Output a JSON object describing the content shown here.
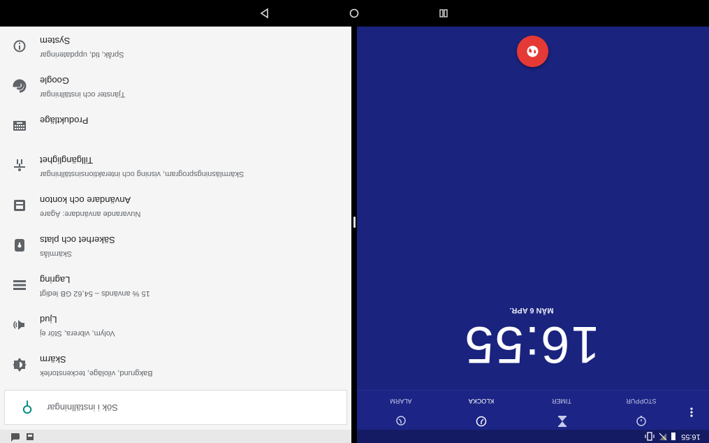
{
  "settings": {
    "search_placeholder": "Sök i inställningar",
    "items": [
      {
        "icon": "info-icon",
        "title": "System",
        "sub": "Språk, tid, uppdateringar"
      },
      {
        "icon": "google-icon",
        "title": "Google",
        "sub": "Tjänster och inställningar"
      },
      {
        "icon": "keyboard-icon",
        "title": "Produktläge",
        "sub": ""
      },
      {
        "icon": "accessibility-icon",
        "title": "Tillgänglighet",
        "sub": "Skärmläsningsprogram, visning och interaktionsinställningar"
      },
      {
        "icon": "account-icon",
        "title": "Användare och konton",
        "sub": "Nuvarande användare: Ägare"
      },
      {
        "icon": "lock-icon",
        "title": "Säkerhet och plats",
        "sub": "Skärmlås"
      },
      {
        "icon": "storage-icon",
        "title": "Lagring",
        "sub": "15 % används – 54,62 GB ledigt"
      },
      {
        "icon": "volume-icon",
        "title": "Ljud",
        "sub": "Volym, vibrera, Stör ej"
      },
      {
        "icon": "brightness-icon",
        "title": "Skärm",
        "sub": "Bakgrund, viloläge, teckenstorlek"
      }
    ]
  },
  "clock": {
    "time": "16:55",
    "date": "MÅN 6 APR.",
    "tabs": [
      {
        "label": "ALARM",
        "icon": "alarm-icon",
        "active": false
      },
      {
        "label": "KLOCKA",
        "icon": "clock-icon",
        "active": true
      },
      {
        "label": "TIMER",
        "icon": "hourglass-icon",
        "active": false
      },
      {
        "label": "STOPPUR",
        "icon": "stopwatch-icon",
        "active": false
      }
    ],
    "status_time": "16:55"
  },
  "colors": {
    "clock_bg": "#1a237e",
    "fab": "#e53935",
    "accent_teal": "#00897b"
  }
}
